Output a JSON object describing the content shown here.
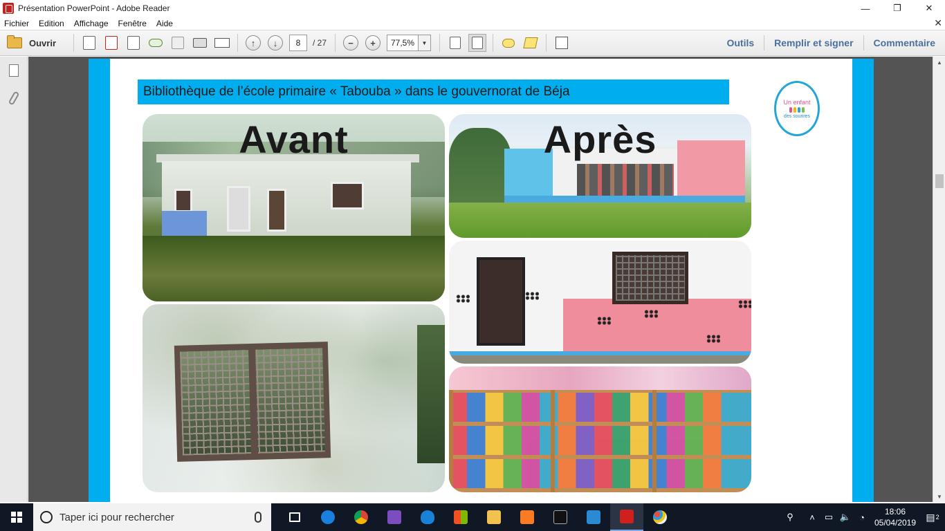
{
  "window": {
    "title": "Présentation PowerPoint - Adobe Reader",
    "minimize": "—",
    "restore": "❐",
    "close": "✕"
  },
  "menu": {
    "items": [
      {
        "label": "Fichier"
      },
      {
        "label": "Edition"
      },
      {
        "label": "Affichage"
      },
      {
        "label": "Fenêtre"
      },
      {
        "label": "Aide"
      }
    ],
    "close_doc": "✕"
  },
  "toolbar": {
    "open_label": "Ouvrir",
    "current_page": "8",
    "total_pages": "/ 27",
    "zoom": "77,5%",
    "tools_label": "Outils",
    "fill_sign_label": "Remplir et signer",
    "comment_label": "Commentaire"
  },
  "document": {
    "slide_title": "Bibliothèque de l’école primaire « Tabouba  » dans le gouvernorat de Béja",
    "before_label": "Avant",
    "after_label": "Après",
    "logo_line1": "Un enfant",
    "logo_line2": "des sourires"
  },
  "taskbar": {
    "search_placeholder": "Taper ici pour rechercher",
    "time": "18:06",
    "date": "05/04/2019",
    "notification_count": "2",
    "icons": [
      "task-view-icon",
      "teamviewer-icon",
      "chrome-icon",
      "visual-studio-icon",
      "edge-icon",
      "store-icon",
      "file-explorer-icon",
      "xampp-icon",
      "terminal-icon",
      "vscode-icon",
      "adobe-reader-icon",
      "paint-icon"
    ]
  },
  "colors": {
    "slide_accent": "#00aeef",
    "doc_background": "#545454",
    "toolbar_link": "#4a6f9e",
    "taskbar": "#101825"
  }
}
